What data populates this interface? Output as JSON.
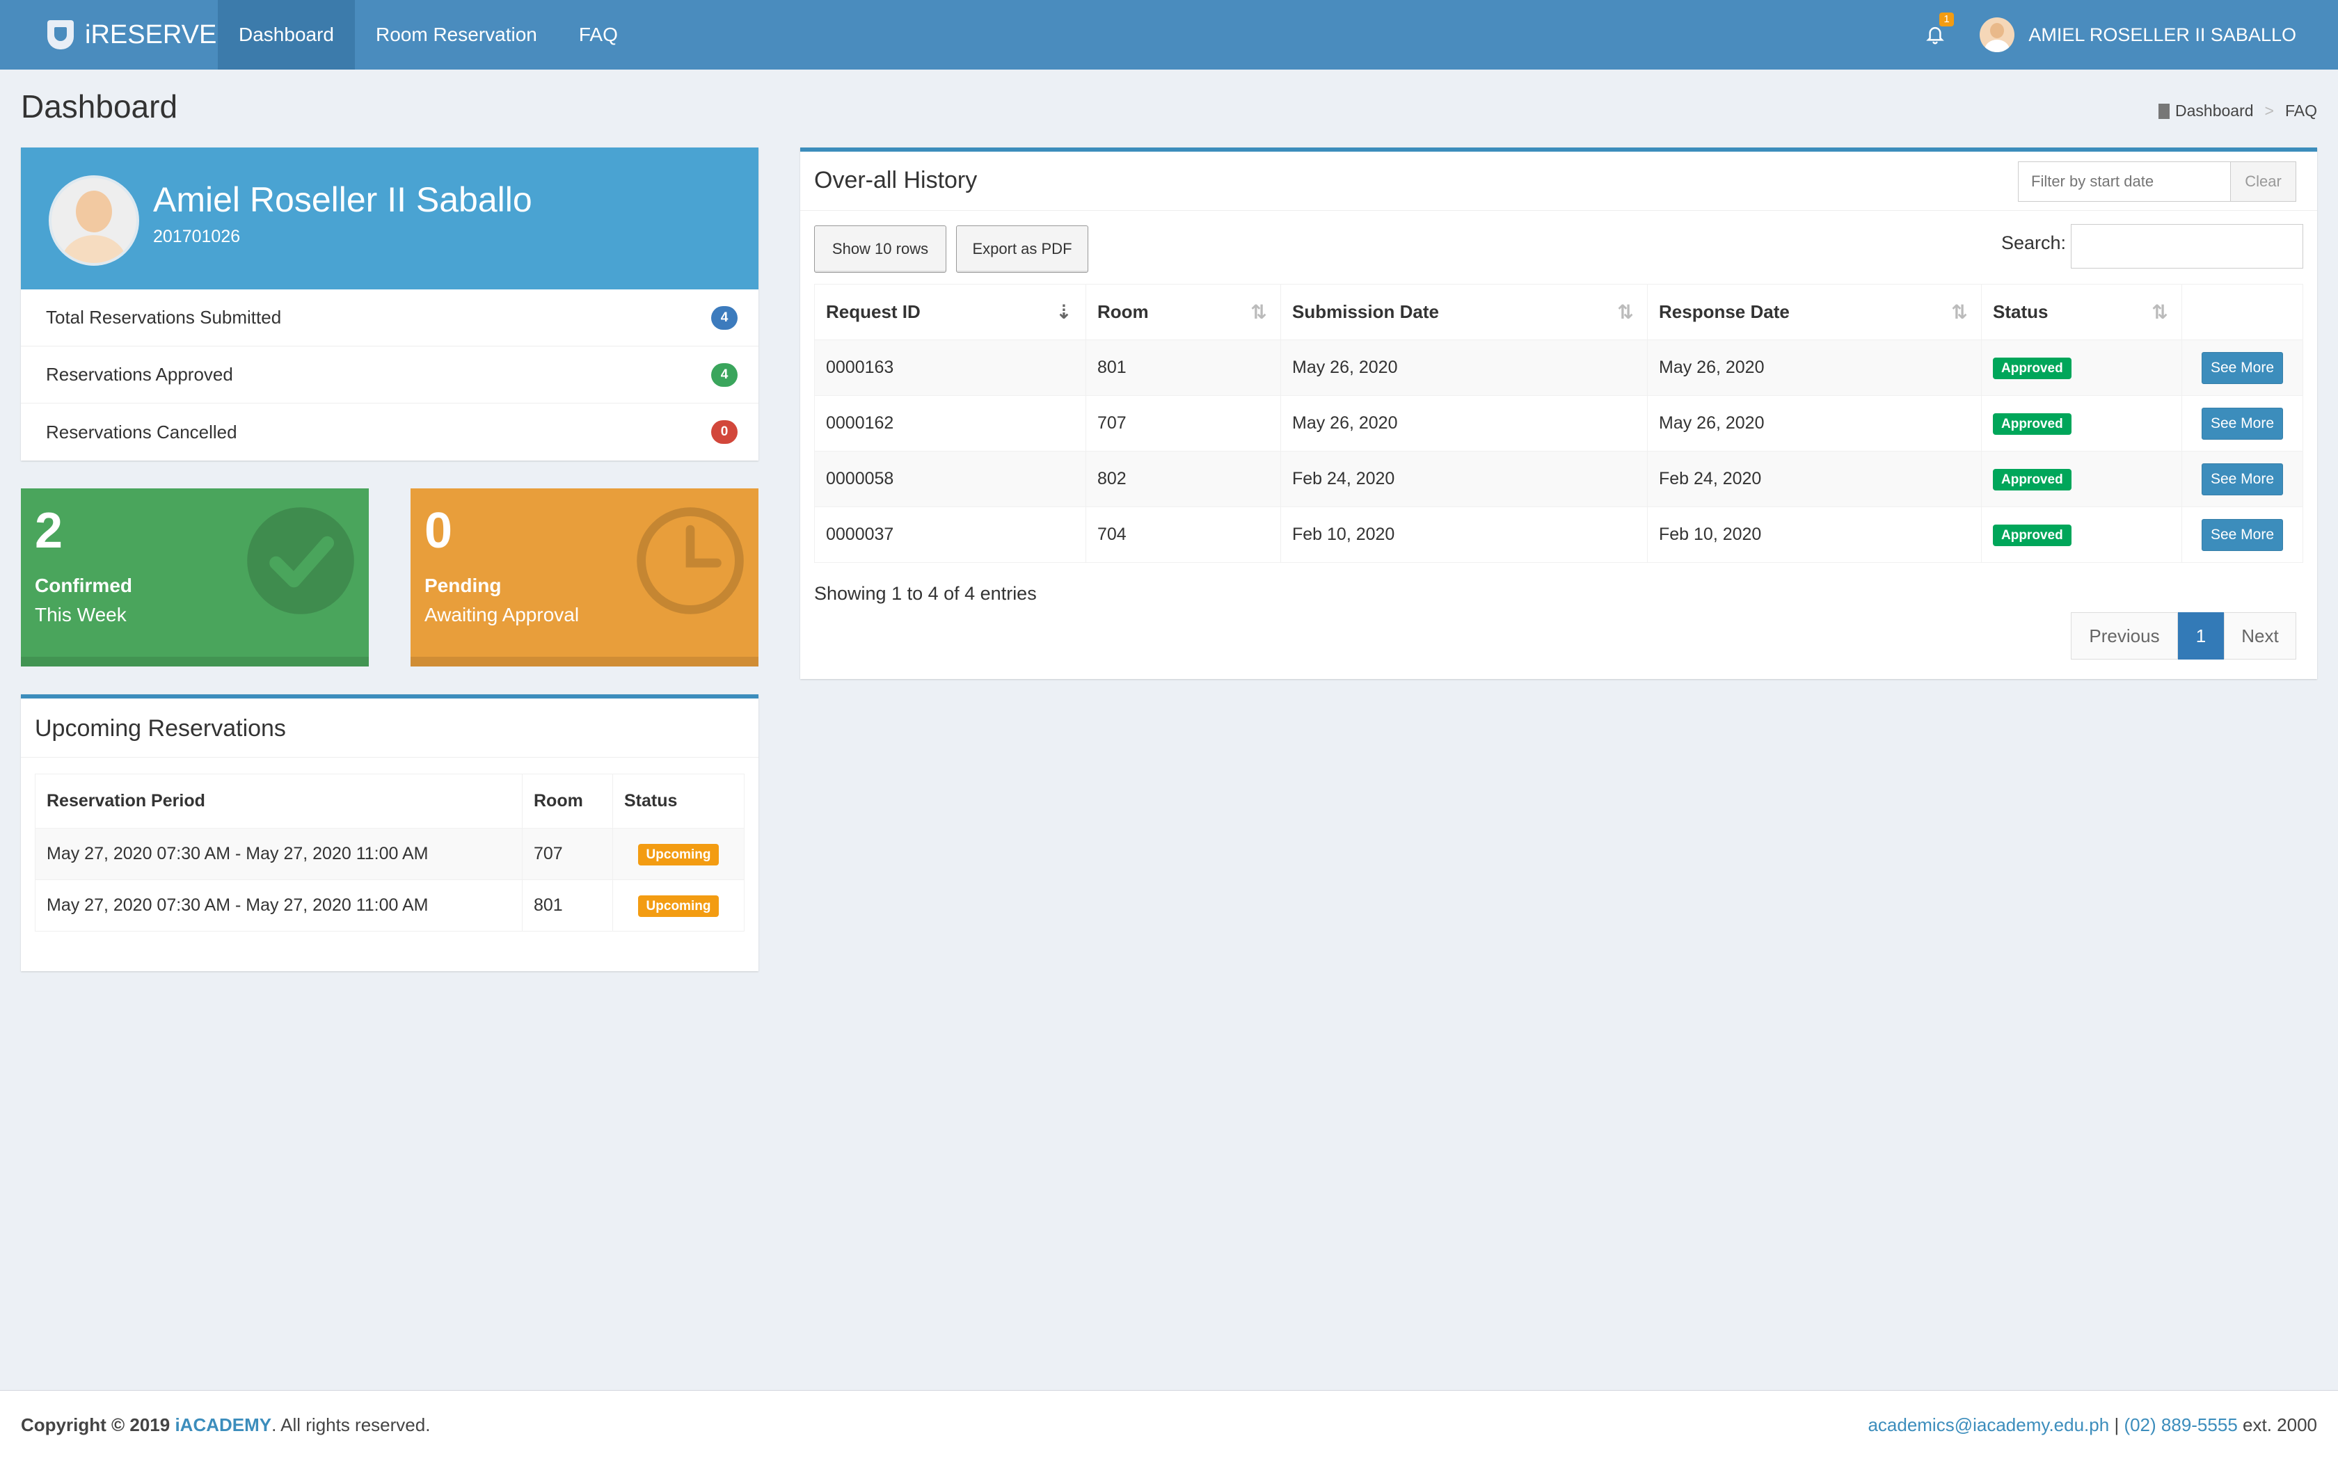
{
  "navbar": {
    "brand": "iRESERVE",
    "items": [
      {
        "label": "Dashboard",
        "active": true
      },
      {
        "label": "Room Reservation",
        "active": false
      },
      {
        "label": "FAQ",
        "active": false
      }
    ],
    "notification_count": "1",
    "user_name": "AMIEL ROSELLER II SABALLO"
  },
  "header": {
    "title": "Dashboard",
    "breadcrumb": [
      "Dashboard",
      ">",
      "FAQ"
    ]
  },
  "profile": {
    "name": "Amiel Roseller II Saballo",
    "id": "201701026",
    "stats": [
      {
        "label": "Total Reservations Submitted",
        "value": "4",
        "color": "#3c7bbd"
      },
      {
        "label": "Reservations Approved",
        "value": "4",
        "color": "#3aa55c"
      },
      {
        "label": "Reservations Cancelled",
        "value": "0",
        "color": "#d2473b"
      }
    ]
  },
  "boxes": {
    "confirmed": {
      "number": "2",
      "title": "Confirmed",
      "subtitle": "This Week",
      "color": "#4aa55c",
      "icon": "check-circle-icon"
    },
    "pending": {
      "number": "0",
      "title": "Pending",
      "subtitle": "Awaiting Approval",
      "color": "#e89e3b",
      "icon": "clock-icon"
    }
  },
  "upcoming": {
    "title": "Upcoming Reservations",
    "columns": [
      "Reservation Period",
      "Room",
      "Status"
    ],
    "rows": [
      {
        "period": "May 27, 2020 07:30 AM - May 27, 2020 11:00 AM",
        "room": "707",
        "status": "Upcoming"
      },
      {
        "period": "May 27, 2020 07:30 AM - May 27, 2020 11:00 AM",
        "room": "801",
        "status": "Upcoming"
      }
    ]
  },
  "history": {
    "title": "Over-all History",
    "filter_placeholder": "Filter by start date",
    "clear_label": "Clear",
    "show_rows_label": "Show 10 rows",
    "export_label": "Export as PDF",
    "search_label": "Search:",
    "columns": [
      "Request ID",
      "Room",
      "Submission Date",
      "Response Date",
      "Status"
    ],
    "see_more_label": "See More",
    "rows": [
      {
        "id": "0000163",
        "room": "801",
        "submitted": "May 26, 2020",
        "response": "May 26, 2020",
        "status": "Approved"
      },
      {
        "id": "0000162",
        "room": "707",
        "submitted": "May 26, 2020",
        "response": "May 26, 2020",
        "status": "Approved"
      },
      {
        "id": "0000058",
        "room": "802",
        "submitted": "Feb 24, 2020",
        "response": "Feb 24, 2020",
        "status": "Approved"
      },
      {
        "id": "0000037",
        "room": "704",
        "submitted": "Feb 10, 2020",
        "response": "Feb 10, 2020",
        "status": "Approved"
      }
    ],
    "showing_text": "Showing 1 to 4 of 4 entries",
    "pagination": {
      "previous": "Previous",
      "current": "1",
      "next": "Next"
    }
  },
  "footer": {
    "copyright_prefix": "Copyright © 2019",
    "org": "iACADEMY",
    "rights": ". All rights reserved.",
    "email": "academics@iacademy.edu.ph",
    "separator": "|",
    "phone": "(02) 889-5555",
    "ext": "ext. 2000"
  }
}
